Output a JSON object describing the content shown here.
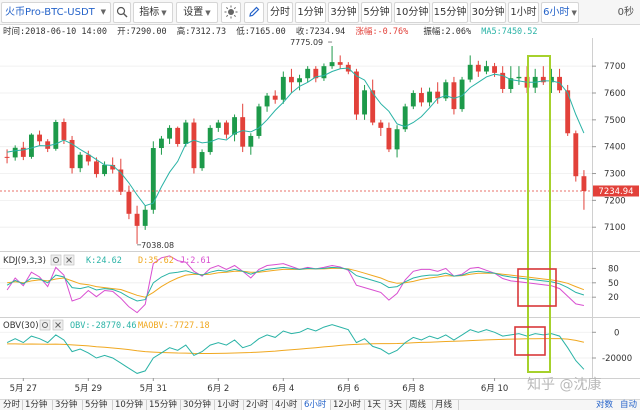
{
  "toolbar": {
    "symbol": "火币Pro-BTC-USDT",
    "indicators_label": "指标",
    "settings_label": "设置",
    "theme_icon": "sun-icon",
    "draw_icon": "pencil-icon",
    "intervals": [
      "分时",
      "1分钟",
      "3分钟",
      "5分钟",
      "10分钟",
      "15分钟",
      "30分钟",
      "1小时"
    ],
    "active_interval": "6小时",
    "countdown": "0秒"
  },
  "info": {
    "time_label": "时间:2018-06-10 14:00",
    "open_label": "开:7290.00",
    "high_label": "高:7312.73",
    "low_label": "低:7165.00",
    "close_label": "收:7234.94",
    "change_label": "涨幅:-0.76%",
    "amplitude_label": "振幅:2.06%",
    "ma_label": "MA5:7450.52"
  },
  "price_axis": {
    "ticks": [
      "7700",
      "7600",
      "7500",
      "7400",
      "7300",
      "7200",
      "7100"
    ],
    "current_price": "7234.94"
  },
  "annotations": {
    "high_marker": "7775.09",
    "low_marker": "7038.08"
  },
  "kdj": {
    "title": "KDJ(9,3,3)",
    "k_label": "K:24.62",
    "d_label": "D:35.62",
    "j_label": "J:2.61",
    "ticks": [
      "80",
      "50",
      "20"
    ]
  },
  "obv": {
    "title": "OBV(30)",
    "obv_label": "OBV:-28770.46",
    "maobv_label": "MAOBV:-7727.18",
    "ticks": [
      "0",
      "-20000"
    ]
  },
  "date_axis": [
    "5月 27",
    "5月 29",
    "5月 31",
    "6月 2",
    "6月 4",
    "6月 6",
    "6月 8",
    "6月 10"
  ],
  "bottom_bar": {
    "intervals": [
      "分时",
      "1分钟",
      "3分钟",
      "5分钟",
      "10分钟",
      "15分钟",
      "30分钟",
      "1小时",
      "2小时",
      "4小时",
      "6小时",
      "12小时",
      "1天",
      "3天",
      "周线",
      "月线"
    ],
    "active": "6小时",
    "right_links": [
      "对数",
      "自动"
    ]
  },
  "watermark": "知乎 @沈康",
  "colors": {
    "up": "#1d9a4a",
    "down": "#e2413a",
    "ma": "#2ab3a6",
    "k_line": "#2ab3a6",
    "d_line": "#f0a820",
    "j_line": "#d94fd1",
    "highlight_green": "#a6d12c",
    "highlight_red": "#d9383a"
  },
  "chart_data": {
    "type": "candlestick",
    "candles": [
      {
        "o": 7362,
        "h": 7390,
        "l": 7338,
        "c": 7360
      },
      {
        "o": 7360,
        "h": 7405,
        "l": 7348,
        "c": 7396
      },
      {
        "o": 7396,
        "h": 7418,
        "l": 7350,
        "c": 7362
      },
      {
        "o": 7362,
        "h": 7450,
        "l": 7355,
        "c": 7445
      },
      {
        "o": 7445,
        "h": 7460,
        "l": 7405,
        "c": 7420
      },
      {
        "o": 7420,
        "h": 7428,
        "l": 7380,
        "c": 7392
      },
      {
        "o": 7392,
        "h": 7500,
        "l": 7385,
        "c": 7492
      },
      {
        "o": 7492,
        "h": 7505,
        "l": 7410,
        "c": 7425
      },
      {
        "o": 7425,
        "h": 7440,
        "l": 7300,
        "c": 7320
      },
      {
        "o": 7320,
        "h": 7380,
        "l": 7305,
        "c": 7370
      },
      {
        "o": 7370,
        "h": 7385,
        "l": 7330,
        "c": 7345
      },
      {
        "o": 7345,
        "h": 7360,
        "l": 7285,
        "c": 7298
      },
      {
        "o": 7298,
        "h": 7345,
        "l": 7290,
        "c": 7332
      },
      {
        "o": 7332,
        "h": 7360,
        "l": 7300,
        "c": 7315
      },
      {
        "o": 7315,
        "h": 7355,
        "l": 7220,
        "c": 7232
      },
      {
        "o": 7232,
        "h": 7255,
        "l": 7130,
        "c": 7150
      },
      {
        "o": 7150,
        "h": 7180,
        "l": 7038,
        "c": 7105
      },
      {
        "o": 7105,
        "h": 7180,
        "l": 7090,
        "c": 7165
      },
      {
        "o": 7165,
        "h": 7420,
        "l": 7150,
        "c": 7395
      },
      {
        "o": 7395,
        "h": 7440,
        "l": 7370,
        "c": 7430
      },
      {
        "o": 7430,
        "h": 7480,
        "l": 7410,
        "c": 7470
      },
      {
        "o": 7470,
        "h": 7475,
        "l": 7400,
        "c": 7410
      },
      {
        "o": 7410,
        "h": 7500,
        "l": 7400,
        "c": 7490
      },
      {
        "o": 7490,
        "h": 7505,
        "l": 7300,
        "c": 7320
      },
      {
        "o": 7320,
        "h": 7390,
        "l": 7310,
        "c": 7380
      },
      {
        "o": 7380,
        "h": 7480,
        "l": 7370,
        "c": 7470
      },
      {
        "o": 7470,
        "h": 7500,
        "l": 7455,
        "c": 7490
      },
      {
        "o": 7490,
        "h": 7498,
        "l": 7430,
        "c": 7445
      },
      {
        "o": 7445,
        "h": 7520,
        "l": 7420,
        "c": 7510
      },
      {
        "o": 7510,
        "h": 7560,
        "l": 7380,
        "c": 7400
      },
      {
        "o": 7400,
        "h": 7450,
        "l": 7370,
        "c": 7440
      },
      {
        "o": 7440,
        "h": 7560,
        "l": 7430,
        "c": 7550
      },
      {
        "o": 7550,
        "h": 7600,
        "l": 7530,
        "c": 7590
      },
      {
        "o": 7590,
        "h": 7610,
        "l": 7560,
        "c": 7575
      },
      {
        "o": 7575,
        "h": 7680,
        "l": 7560,
        "c": 7660
      },
      {
        "o": 7660,
        "h": 7690,
        "l": 7600,
        "c": 7640
      },
      {
        "o": 7640,
        "h": 7668,
        "l": 7610,
        "c": 7655
      },
      {
        "o": 7655,
        "h": 7700,
        "l": 7640,
        "c": 7690
      },
      {
        "o": 7690,
        "h": 7700,
        "l": 7640,
        "c": 7655
      },
      {
        "o": 7655,
        "h": 7710,
        "l": 7645,
        "c": 7700
      },
      {
        "o": 7700,
        "h": 7775,
        "l": 7690,
        "c": 7715
      },
      {
        "o": 7715,
        "h": 7740,
        "l": 7690,
        "c": 7705
      },
      {
        "o": 7705,
        "h": 7715,
        "l": 7670,
        "c": 7680
      },
      {
        "o": 7680,
        "h": 7690,
        "l": 7500,
        "c": 7520
      },
      {
        "o": 7520,
        "h": 7630,
        "l": 7500,
        "c": 7610
      },
      {
        "o": 7610,
        "h": 7650,
        "l": 7480,
        "c": 7490
      },
      {
        "o": 7490,
        "h": 7500,
        "l": 7440,
        "c": 7470
      },
      {
        "o": 7470,
        "h": 7490,
        "l": 7380,
        "c": 7390
      },
      {
        "o": 7390,
        "h": 7480,
        "l": 7360,
        "c": 7465
      },
      {
        "o": 7465,
        "h": 7560,
        "l": 7455,
        "c": 7550
      },
      {
        "o": 7550,
        "h": 7610,
        "l": 7540,
        "c": 7600
      },
      {
        "o": 7600,
        "h": 7620,
        "l": 7550,
        "c": 7565
      },
      {
        "o": 7565,
        "h": 7620,
        "l": 7550,
        "c": 7605
      },
      {
        "o": 7605,
        "h": 7640,
        "l": 7560,
        "c": 7580
      },
      {
        "o": 7580,
        "h": 7650,
        "l": 7570,
        "c": 7640
      },
      {
        "o": 7640,
        "h": 7660,
        "l": 7520,
        "c": 7540
      },
      {
        "o": 7540,
        "h": 7660,
        "l": 7530,
        "c": 7650
      },
      {
        "o": 7650,
        "h": 7740,
        "l": 7640,
        "c": 7705
      },
      {
        "o": 7705,
        "h": 7720,
        "l": 7660,
        "c": 7680
      },
      {
        "o": 7680,
        "h": 7720,
        "l": 7670,
        "c": 7700
      },
      {
        "o": 7700,
        "h": 7712,
        "l": 7660,
        "c": 7675
      },
      {
        "o": 7675,
        "h": 7700,
        "l": 7600,
        "c": 7615
      },
      {
        "o": 7615,
        "h": 7700,
        "l": 7600,
        "c": 7655
      },
      {
        "o": 7655,
        "h": 7700,
        "l": 7630,
        "c": 7660
      },
      {
        "o": 7660,
        "h": 7700,
        "l": 7600,
        "c": 7620
      },
      {
        "o": 7620,
        "h": 7690,
        "l": 7600,
        "c": 7660
      },
      {
        "o": 7660,
        "h": 7700,
        "l": 7630,
        "c": 7640
      },
      {
        "o": 7640,
        "h": 7690,
        "l": 7600,
        "c": 7660
      },
      {
        "o": 7660,
        "h": 7690,
        "l": 7600,
        "c": 7610
      },
      {
        "o": 7610,
        "h": 7630,
        "l": 7440,
        "c": 7450
      },
      {
        "o": 7450,
        "h": 7460,
        "l": 7270,
        "c": 7290
      },
      {
        "o": 7290,
        "h": 7312.73,
        "l": 7165,
        "c": 7234.94
      }
    ],
    "ma5": [
      7380,
      7385,
      7388,
      7395,
      7404,
      7403,
      7410,
      7425,
      7410,
      7390,
      7372,
      7352,
      7332,
      7330,
      7303,
      7265,
      7220,
      7180,
      7190,
      7250,
      7305,
      7345,
      7410,
      7424,
      7414,
      7418,
      7430,
      7425,
      7450,
      7460,
      7455,
      7470,
      7500,
      7535,
      7565,
      7600,
      7625,
      7640,
      7660,
      7665,
      7680,
      7690,
      7693,
      7664,
      7648,
      7600,
      7560,
      7532,
      7485,
      7475,
      7490,
      7512,
      7545,
      7580,
      7590,
      7580,
      7590,
      7620,
      7640,
      7660,
      7670,
      7665,
      7650,
      7645,
      7640,
      7640,
      7645,
      7645,
      7638,
      7600,
      7520,
      7450.52
    ],
    "kdj_k": [
      45,
      55,
      48,
      60,
      58,
      50,
      66,
      62,
      40,
      38,
      42,
      35,
      38,
      36,
      30,
      20,
      12,
      15,
      50,
      62,
      70,
      72,
      75,
      70,
      66,
      72,
      76,
      74,
      78,
      74,
      68,
      74,
      78,
      80,
      82,
      80,
      78,
      80,
      79,
      80,
      82,
      81,
      78,
      65,
      60,
      55,
      50,
      40,
      42,
      52,
      60,
      64,
      66,
      66,
      70,
      64,
      66,
      72,
      74,
      72,
      70,
      65,
      62,
      60,
      58,
      56,
      54,
      52,
      48,
      40,
      30,
      24.62
    ],
    "kdj_d": [
      50,
      52,
      50,
      54,
      56,
      54,
      58,
      60,
      54,
      48,
      46,
      42,
      40,
      38,
      36,
      30,
      24,
      20,
      30,
      42,
      52,
      60,
      66,
      68,
      67,
      68,
      71,
      72,
      74,
      74,
      72,
      72,
      74,
      76,
      78,
      78,
      78,
      79,
      79,
      79,
      80,
      80,
      79,
      75,
      70,
      65,
      60,
      53,
      49,
      50,
      53,
      57,
      60,
      62,
      65,
      64,
      65,
      68,
      70,
      70,
      70,
      68,
      66,
      64,
      62,
      60,
      58,
      56,
      53,
      49,
      42,
      35.62
    ],
    "kdj_j": [
      35,
      60,
      44,
      72,
      62,
      42,
      82,
      66,
      12,
      18,
      34,
      21,
      34,
      32,
      18,
      0,
      -12,
      5,
      90,
      102,
      106,
      96,
      93,
      74,
      64,
      80,
      86,
      78,
      86,
      74,
      60,
      78,
      86,
      88,
      90,
      84,
      78,
      82,
      79,
      82,
      86,
      83,
      76,
      45,
      40,
      35,
      30,
      14,
      28,
      56,
      74,
      78,
      78,
      74,
      80,
      64,
      68,
      80,
      82,
      76,
      70,
      59,
      54,
      52,
      50,
      48,
      46,
      44,
      38,
      22,
      6,
      2.61
    ],
    "obv": [
      -8000,
      -5000,
      -8000,
      -3000,
      -5000,
      -8000,
      -2000,
      -6000,
      -15000,
      -13000,
      -16000,
      -20000,
      -18000,
      -20000,
      -24000,
      -28000,
      -32000,
      -30000,
      -20000,
      -16000,
      -12000,
      -14000,
      -10000,
      -18000,
      -15000,
      -10000,
      -8000,
      -10000,
      -6000,
      -12000,
      -10000,
      -5000,
      -2000,
      -4000,
      1000,
      -1000,
      0,
      3000,
      1000,
      4000,
      6000,
      4000,
      2000,
      -8000,
      -5000,
      -11000,
      -13000,
      -17000,
      -14000,
      -8000,
      -4000,
      -6000,
      -3000,
      -5000,
      -2000,
      -6000,
      -2000,
      2000,
      0,
      2000,
      0,
      -3000,
      -2000,
      -1000,
      -3000,
      -1000,
      -2000,
      -1000,
      -3000,
      -12000,
      -22000,
      -28770.46
    ],
    "maobv": [
      -9000,
      -9000,
      -9200,
      -9100,
      -9200,
      -9300,
      -9200,
      -9400,
      -9800,
      -10200,
      -10600,
      -11200,
      -11700,
      -12200,
      -12800,
      -13500,
      -14300,
      -15000,
      -15400,
      -15700,
      -15900,
      -16100,
      -16200,
      -16400,
      -16500,
      -16500,
      -16400,
      -16300,
      -16100,
      -15900,
      -15700,
      -15400,
      -15000,
      -14600,
      -14100,
      -13600,
      -13100,
      -12500,
      -12000,
      -11400,
      -10800,
      -10200,
      -9700,
      -9400,
      -9100,
      -8900,
      -8800,
      -8800,
      -8700,
      -8500,
      -8200,
      -7900,
      -7700,
      -7500,
      -7200,
      -7000,
      -6800,
      -6500,
      -6200,
      -5900,
      -5700,
      -5500,
      -5300,
      -5200,
      -5100,
      -5000,
      -4900,
      -4900,
      -4900,
      -5300,
      -6300,
      -7727.18
    ],
    "price_range": [
      7030,
      7790
    ],
    "kdj_range": [
      -15,
      110
    ],
    "obv_range": [
      -34000,
      8000
    ]
  }
}
